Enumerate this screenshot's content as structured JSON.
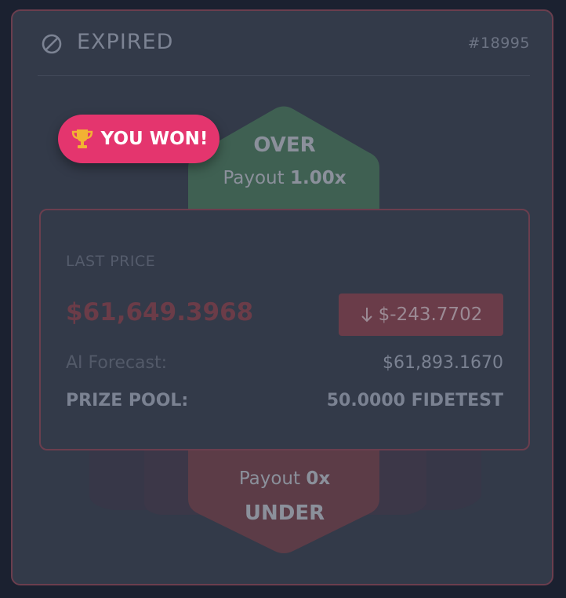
{
  "header": {
    "status_icon": "prohibited-icon",
    "status": "EXPIRED",
    "round_id": "#18995"
  },
  "badge": {
    "icon": "trophy-icon",
    "text": "YOU WON!"
  },
  "over": {
    "label": "OVER",
    "payout_label": "Payout",
    "payout_value": "1.00x"
  },
  "under": {
    "label": "UNDER",
    "payout_label": "Payout",
    "payout_value": "0x"
  },
  "price": {
    "last_price_label": "LAST PRICE",
    "last_price_value": "$61,649.3968",
    "change_icon": "arrow-down-icon",
    "change_value": "$-243.7702",
    "forecast_label": "AI Forecast:",
    "forecast_value": "$61,893.1670",
    "prize_pool_label": "PRIZE POOL:",
    "prize_pool_value": "50.0000 FIDETEST"
  },
  "colors": {
    "card_border": "#6b3e4e",
    "over_green": "#3f6052",
    "under_red": "#5c3c47",
    "badge_pink": "#e4356e",
    "trophy_gold": "#f2b233"
  }
}
